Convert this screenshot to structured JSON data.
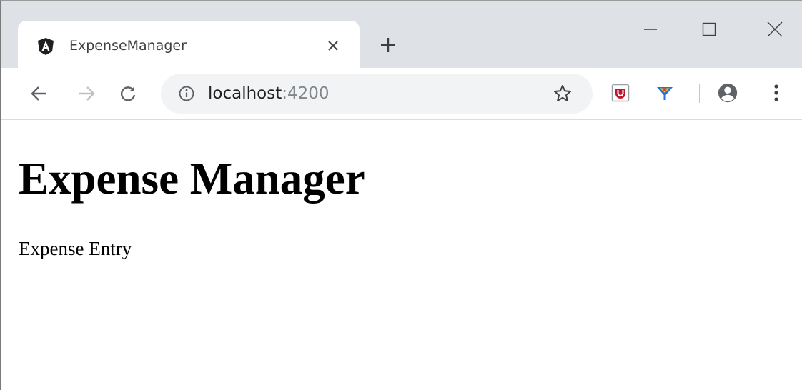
{
  "browser": {
    "tab": {
      "favicon": "angular-logo-icon",
      "title": "ExpenseManager",
      "close_icon": "close-icon"
    },
    "new_tab_icon": "plus-icon",
    "window_controls": [
      "minimize-icon",
      "maximize-icon",
      "close-icon"
    ],
    "nav": [
      "back-arrow-icon",
      "forward-arrow-icon",
      "reload-icon"
    ],
    "address_bar": {
      "info_icon": "info-icon",
      "url_host": "localhost",
      "url_port": ":4200",
      "bookmark_icon": "star-icon"
    },
    "extensions": [
      "mcafee-extension-icon",
      "funnel-extension-icon"
    ],
    "profile_icon": "account-circle-icon",
    "menu_icon": "more-vert-icon",
    "colors": {
      "tabstrip": "#dee1e6",
      "omnibox": "#f1f3f4",
      "text_secondary": "#80868b"
    }
  },
  "page": {
    "heading": "Expense Manager",
    "text": "Expense Entry"
  }
}
